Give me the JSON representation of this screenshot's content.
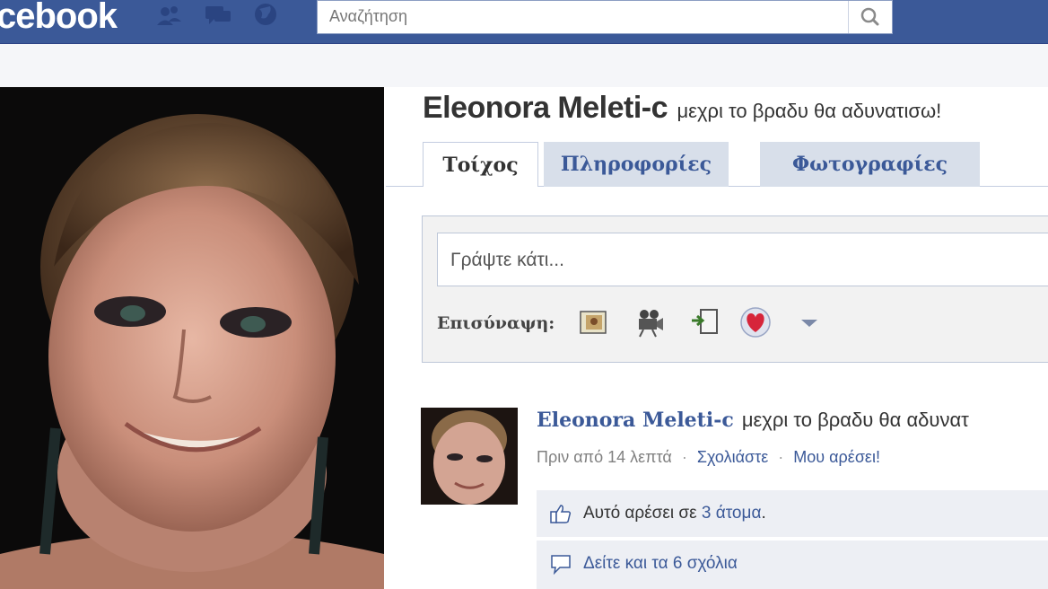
{
  "header": {
    "logo_text": "cebook",
    "search_placeholder": "Αναζήτηση"
  },
  "profile": {
    "name": "Eleonora Meleti-c",
    "status": "μεχρι το βραδυ θα αδυνατισω!"
  },
  "tabs": [
    {
      "label": "Τοίχος",
      "active": true
    },
    {
      "label": "Πληροφορίες",
      "active": false
    },
    {
      "label": "Φωτογραφίες",
      "active": false
    }
  ],
  "composer": {
    "placeholder": "Γράψτε κάτι...",
    "attach_label": "Επισύναψη:",
    "attach_icons": [
      "photo-icon",
      "video-icon",
      "link-icon",
      "heart-icon",
      "dropdown-arrow-icon"
    ]
  },
  "post": {
    "author": "Eleonora Meleti-c",
    "text": "μεχρι το βραδυ θα αδυνατ",
    "time": "Πριν από 14 λεπτά",
    "comment_link": "Σχολιάστε",
    "like_link": "Μου αρέσει!",
    "likes_prefix": "Αυτό αρέσει σε",
    "likes_count": "3 άτομα",
    "likes_suffix": ".",
    "comments_text": "Δείτε και τα 6 σχόλια"
  },
  "colors": {
    "brand": "#3b5998",
    "tab_inactive": "#d8dfea",
    "ufi_bg": "#edeff4"
  }
}
